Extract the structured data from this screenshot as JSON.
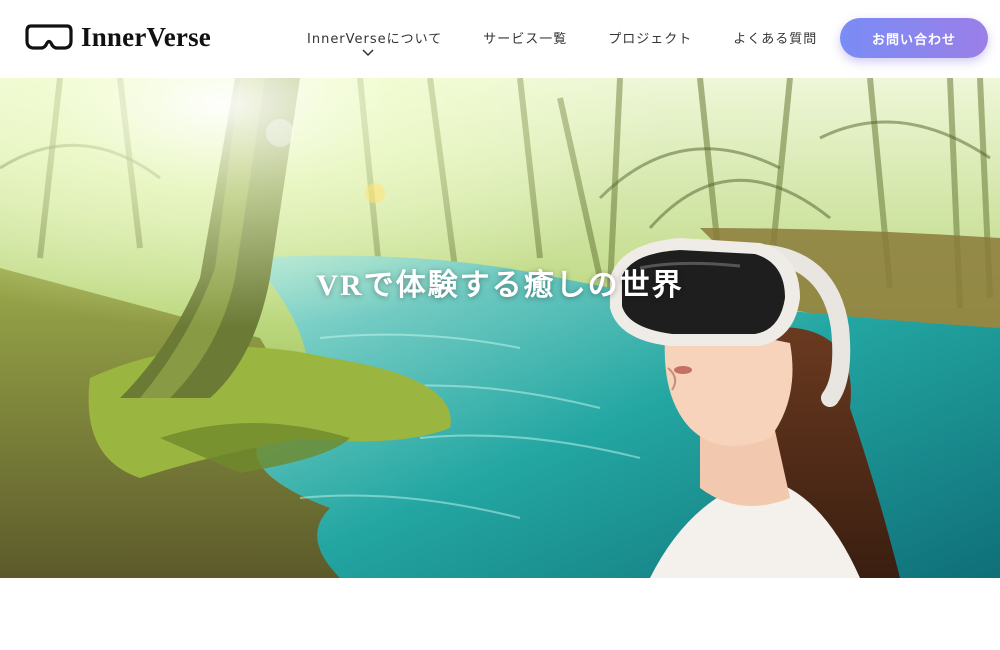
{
  "header": {
    "logo_text": "InnerVerse",
    "logo_icon": "vr-goggles-icon",
    "nav": [
      {
        "label": "InnerVerseについて",
        "has_dropdown": true
      },
      {
        "label": "サービス一覧"
      },
      {
        "label": "プロジェクト"
      },
      {
        "label": "よくある質問"
      }
    ],
    "cta_label": "お問い合わせ"
  },
  "hero": {
    "title": "VRで体験する癒しの世界"
  },
  "colors": {
    "cta_start": "#7a8cf5",
    "cta_end": "#9b7fe8",
    "stream": "#1fa3a0",
    "forest": "#8fb845"
  }
}
